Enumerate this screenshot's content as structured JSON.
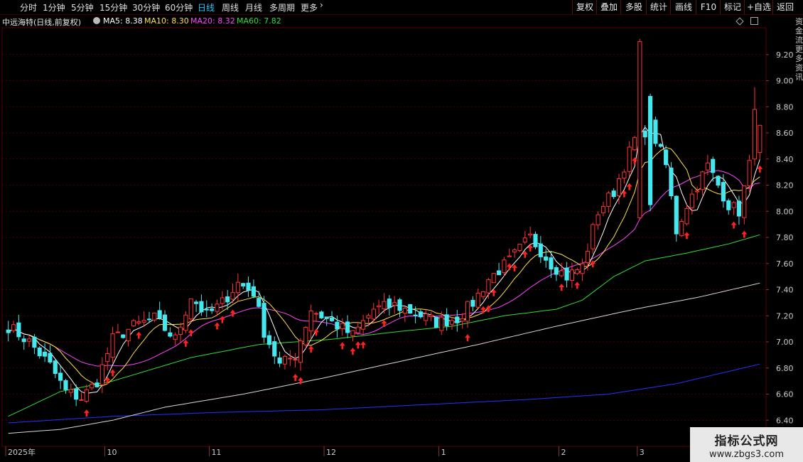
{
  "toolbar": {
    "tabs": [
      "分时",
      "1分钟",
      "5分钟",
      "15分钟",
      "30分钟",
      "60分钟",
      "日线",
      "周线",
      "月线",
      "多周期",
      "更多"
    ],
    "active_tab": "日线",
    "more_chevron": "chevron-right-icon",
    "right_buttons": [
      "复权",
      "叠加",
      "多股",
      "统计",
      "画线",
      "F10",
      "标记",
      "+自选",
      "返回"
    ]
  },
  "info": {
    "title": "中远海特(日线,前复权)",
    "dropdown_icon": "chevron-down-icon",
    "ma5": "MA5: 8.38",
    "ma10": "MA10: 8.30",
    "ma20": "MA20: 8.32",
    "ma60": "MA60: 7.82"
  },
  "side_text": "资金流 更 多 资 讯",
  "watermark": {
    "line1": "指标公式网",
    "line2": "www.zbgs3.com"
  },
  "colors": {
    "up": "#ff3333",
    "down": "#46e8f0",
    "ma5": "#ffffff",
    "ma10": "#ffe14a",
    "ma20": "#ff44ff",
    "ma60": "#33dd33",
    "ma120": "#d8d8d8",
    "ma250": "#2233ff",
    "arrow": "#ff2222",
    "grid": "#4a0000",
    "axis_text": "#cccccc",
    "tab_active": "#26c6f5"
  },
  "chart_data": {
    "type": "candlestick",
    "title": "中远海特(日线,前复权)",
    "y_ticks": [
      "9.20",
      "9.00",
      "8.80",
      "8.60",
      "8.40",
      "8.20",
      "8.00",
      "7.80",
      "7.60",
      "7.40",
      "7.20",
      "7.00",
      "6.80",
      "6.60",
      "6.40"
    ],
    "ylim": [
      6.2,
      9.4
    ],
    "x_labels": [
      "2025年",
      "10",
      "11",
      "12",
      "1",
      "2",
      "3"
    ],
    "x_label_positions": [
      0,
      19,
      39,
      61,
      83,
      106,
      121
    ],
    "n_bars": 145,
    "keyframes_close": [
      [
        0,
        7.12
      ],
      [
        4,
        7.0
      ],
      [
        8,
        6.82
      ],
      [
        11,
        6.62
      ],
      [
        14,
        6.57
      ],
      [
        17,
        6.7
      ],
      [
        20,
        7.02
      ],
      [
        24,
        7.12
      ],
      [
        28,
        7.18
      ],
      [
        32,
        7.02
      ],
      [
        35,
        7.35
      ],
      [
        38,
        7.2
      ],
      [
        41,
        7.3
      ],
      [
        44,
        7.45
      ],
      [
        47,
        7.38
      ],
      [
        49,
        7.08
      ],
      [
        52,
        6.82
      ],
      [
        55,
        6.9
      ],
      [
        58,
        7.25
      ],
      [
        62,
        7.15
      ],
      [
        66,
        7.05
      ],
      [
        70,
        7.25
      ],
      [
        74,
        7.28
      ],
      [
        78,
        7.22
      ],
      [
        82,
        7.15
      ],
      [
        86,
        7.18
      ],
      [
        89,
        7.3
      ],
      [
        92,
        7.48
      ],
      [
        96,
        7.62
      ],
      [
        100,
        7.8
      ],
      [
        104,
        7.6
      ],
      [
        107,
        7.5
      ],
      [
        110,
        7.58
      ],
      [
        113,
        8.0
      ],
      [
        116,
        8.15
      ],
      [
        118,
        8.35
      ],
      [
        120,
        8.55
      ],
      [
        123,
        8.65
      ],
      [
        126,
        8.35
      ],
      [
        128,
        7.85
      ],
      [
        130,
        8.05
      ],
      [
        132,
        8.2
      ],
      [
        134,
        8.35
      ],
      [
        136,
        8.2
      ],
      [
        138,
        8.05
      ],
      [
        140,
        8.0
      ],
      [
        142,
        8.35
      ],
      [
        144,
        8.62
      ]
    ],
    "big_candles": [
      [
        121,
        7.95,
        9.3,
        8.3,
        9.32
      ],
      [
        123,
        8.88,
        8.05,
        8.9,
        8.0
      ],
      [
        143,
        8.4,
        8.78,
        8.35,
        8.95
      ]
    ],
    "ma": [
      {
        "name": "MA5",
        "value": 8.38
      },
      {
        "name": "MA10",
        "value": 8.3
      },
      {
        "name": "MA20",
        "value": 8.32
      },
      {
        "name": "MA60",
        "value": 7.82
      }
    ],
    "ma60_keyframes": [
      [
        0,
        6.43
      ],
      [
        10,
        6.62
      ],
      [
        20,
        6.7
      ],
      [
        35,
        6.88
      ],
      [
        48,
        6.98
      ],
      [
        62,
        7.02
      ],
      [
        75,
        7.08
      ],
      [
        85,
        7.12
      ],
      [
        95,
        7.2
      ],
      [
        105,
        7.25
      ],
      [
        110,
        7.32
      ],
      [
        116,
        7.5
      ],
      [
        122,
        7.62
      ],
      [
        130,
        7.68
      ],
      [
        138,
        7.75
      ],
      [
        144,
        7.82
      ]
    ],
    "ma120_keyframes": [
      [
        0,
        6.3
      ],
      [
        10,
        6.33
      ],
      [
        20,
        6.4
      ],
      [
        30,
        6.5
      ],
      [
        45,
        6.6
      ],
      [
        60,
        6.72
      ],
      [
        75,
        6.85
      ],
      [
        90,
        6.98
      ],
      [
        105,
        7.12
      ],
      [
        120,
        7.25
      ],
      [
        132,
        7.34
      ],
      [
        144,
        7.45
      ]
    ],
    "ma250_keyframes": [
      [
        0,
        6.38
      ],
      [
        20,
        6.43
      ],
      [
        40,
        6.46
      ],
      [
        60,
        6.48
      ],
      [
        80,
        6.52
      ],
      [
        100,
        6.56
      ],
      [
        115,
        6.6
      ],
      [
        128,
        6.68
      ],
      [
        144,
        6.83
      ]
    ]
  }
}
